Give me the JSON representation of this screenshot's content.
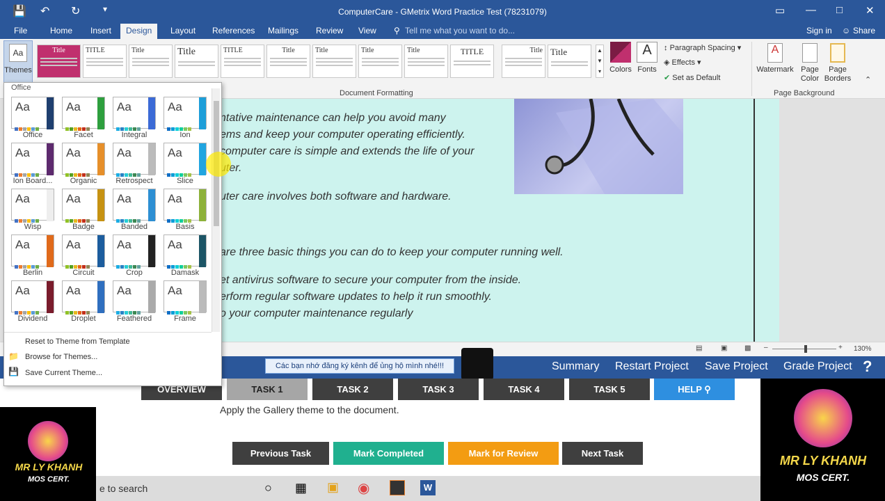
{
  "titlebar": {
    "title": "ComputerCare -  GMetrix Word Practice Test (78231079)",
    "save_icon": "save-icon",
    "undo_icon": "undo-icon",
    "redo_icon": "redo-icon"
  },
  "menu": {
    "tabs": [
      "File",
      "Home",
      "Insert",
      "Design",
      "Layout",
      "References",
      "Mailings",
      "Review",
      "View"
    ],
    "active": "Design",
    "tell_me": "Tell me what you want to do...",
    "sign_in": "Sign in",
    "share": "Share"
  },
  "ribbon": {
    "themes_label": "Themes",
    "document_formatting": "Document Formatting",
    "style_titles": [
      "Title",
      "TITLE",
      "Title",
      "Title",
      "TITLE",
      "Title",
      "Title",
      "Title",
      "Title",
      "TITLE",
      "Title",
      "Title"
    ],
    "colors_label": "Colors",
    "fonts_label": "Fonts",
    "paragraph_spacing": "Paragraph Spacing",
    "effects": "Effects",
    "set_as_default": "Set as Default",
    "watermark": "Watermark",
    "page_color": "Page Color",
    "page_borders": "Page Borders",
    "page_background": "Page Background"
  },
  "themes_dropdown": {
    "section_label": "Office",
    "themes": [
      "Office",
      "Facet",
      "Integral",
      "Ion",
      "Ion Board...",
      "Organic",
      "Retrospect",
      "Slice",
      "Wisp",
      "Badge",
      "Banded",
      "Basis",
      "Berlin",
      "Circuit",
      "Crop",
      "Damask",
      "Dividend",
      "Droplet",
      "Feathered",
      "Frame"
    ],
    "reset": "Reset to Theme from Template",
    "browse": "Browse for Themes...",
    "save": "Save Current Theme..."
  },
  "document": {
    "lines": [
      "ntative maintenance can help you avoid many",
      "ems and keep your computer operating efficiently.",
      "computer care is simple and extends the life of your",
      "uter.",
      "uter care involves both software and hardware.",
      "are three basic things you can do to keep your computer running well.",
      "et antivirus software to secure your computer from the inside.",
      "erform regular software updates to help it run smoothly.",
      "o your computer maintenance regularly"
    ]
  },
  "statusbar": {
    "zoom": "130%"
  },
  "gmetrix": {
    "notice": "Các bạn nhớ đăng ký kênh để ủng hộ mình nhé!!!",
    "links": [
      "Summary",
      "Restart Project",
      "Save Project",
      "Grade Project"
    ],
    "help_icon": "?"
  },
  "tasks": {
    "tabs": [
      "OVERVIEW",
      "TASK 1",
      "TASK 2",
      "TASK 3",
      "TASK 4",
      "TASK 5",
      "HELP"
    ],
    "instruction": "Apply the Gallery theme to the document.",
    "previous": "Previous Task",
    "mark_completed": "Mark Completed",
    "mark_review": "Mark for Review",
    "next": "Next Task"
  },
  "taskbar": {
    "search": "e to search"
  },
  "logo": {
    "text1": "MR LY KHANH",
    "text2": "MOS CERT."
  },
  "colors": {
    "brand": "#2b579a",
    "document_bg": "#cdf3ee",
    "task_active": "#a6a6a6",
    "help": "#2e8fe0",
    "mark_completed": "#20b08f",
    "mark_review": "#f39c12"
  }
}
